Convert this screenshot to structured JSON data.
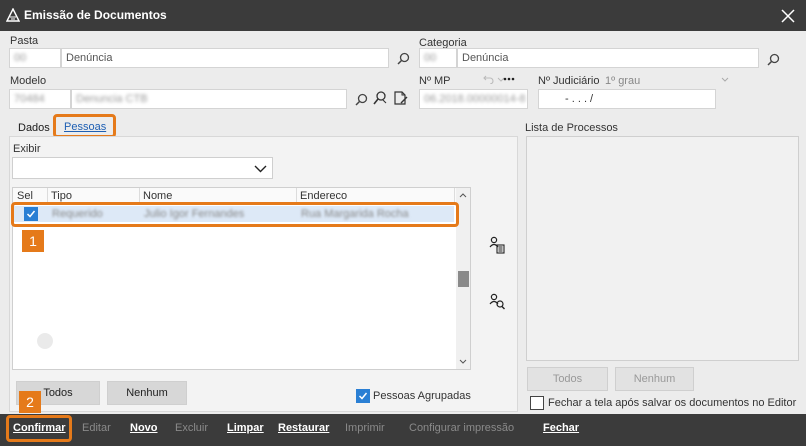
{
  "window": {
    "title": "Emissão de Documentos"
  },
  "form": {
    "pasta": {
      "label": "Pasta",
      "code": "00",
      "value": "Denúncia"
    },
    "categoria": {
      "label": "Categoria",
      "code": "00",
      "value": "Denúncia"
    },
    "modelo": {
      "label": "Modelo",
      "code": "70484",
      "value": "Denuncia CTB"
    },
    "nmp": {
      "label": "Nº MP",
      "value": "06.2018.00000014-8"
    },
    "judiciario": {
      "label": "Nº Judiciário",
      "grau": "1º grau",
      "value": "- .   .   .   /"
    }
  },
  "tabs": [
    {
      "label": "Dados"
    },
    {
      "label": "Pessoas"
    }
  ],
  "pessoas": {
    "exibir_label": "Exibir",
    "columns": [
      "Sel",
      "Tipo",
      "Nome",
      "Endereco"
    ],
    "rows": [
      {
        "selected": true,
        "tipo": "Requerido",
        "nome": "Julio Igor Fernandes",
        "endereco": "Rua Margarida Rocha"
      }
    ],
    "buttons": {
      "todos": "Todos",
      "nenhum": "Nenhum"
    },
    "agrupadas_label": "Pessoas Agrupadas",
    "agrupadas_checked": true
  },
  "annotations": [
    "1",
    "2"
  ],
  "processos": {
    "label": "Lista de Processos",
    "buttons": {
      "todos": "Todos",
      "nenhum": "Nenhum"
    },
    "fechar_label": "Fechar a tela após salvar os documentos no Editor"
  },
  "bottom": {
    "confirmar": "Confirmar",
    "editar": "Editar",
    "novo": "Novo",
    "excluir": "Excluir",
    "limpar": "Limpar",
    "restaurar": "Restaurar",
    "imprimir": "Imprimir",
    "configurar": "Configurar impressão",
    "fechar": "Fechar"
  },
  "colors": {
    "accent": "#e57a1a",
    "titlebar": "#3b3b3b",
    "check": "#2a7fd4",
    "link": "#1e5fb3"
  }
}
